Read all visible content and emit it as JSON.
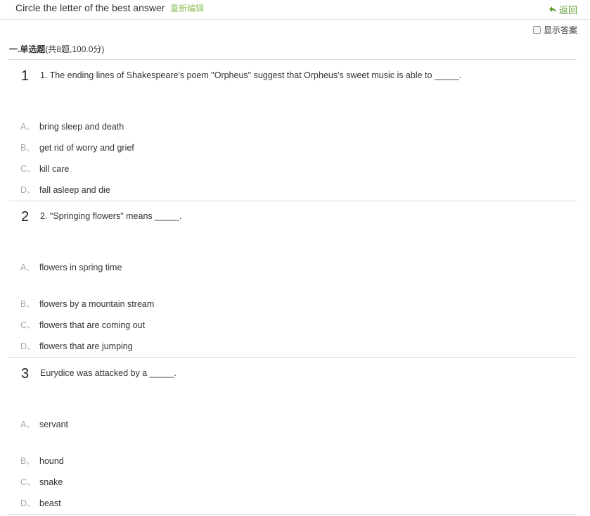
{
  "header": {
    "title": "Circle the letter of the best answer",
    "edit_label": "重新编辑",
    "back_label": "返回"
  },
  "show_answer_label": "显示答案",
  "section": {
    "title": "一.单选题",
    "meta": "(共8题,100.0分)"
  },
  "questions": [
    {
      "number": "1",
      "text": "1. The  ending lines of Shakespeare's poem \"Orpheus\" suggest that Orpheus's sweet music is able to _____.",
      "options": [
        {
          "letter": "A、",
          "text": "bring sleep and death"
        },
        {
          "letter": "B、",
          "text": "get rid of worry and grief"
        },
        {
          "letter": "C、",
          "text": "kill care"
        },
        {
          "letter": "D、",
          "text": "fall asleep and die"
        }
      ]
    },
    {
      "number": "2",
      "text": "2. \"Springing flowers\" means _____.",
      "options": [
        {
          "letter": "A、",
          "text": "flowers in spring time"
        },
        {
          "letter": "B、",
          "text": "flowers by a mountain stream"
        },
        {
          "letter": "C、",
          "text": "flowers that are coming out"
        },
        {
          "letter": "D、",
          "text": "flowers that are jumping"
        }
      ]
    },
    {
      "number": "3",
      "text": " Eurydice was attacked by a _____.",
      "options": [
        {
          "letter": "A、",
          "text": "servant"
        },
        {
          "letter": "B、",
          "text": "hound"
        },
        {
          "letter": "C、",
          "text": "snake"
        },
        {
          "letter": "D、",
          "text": "beast"
        }
      ]
    }
  ]
}
